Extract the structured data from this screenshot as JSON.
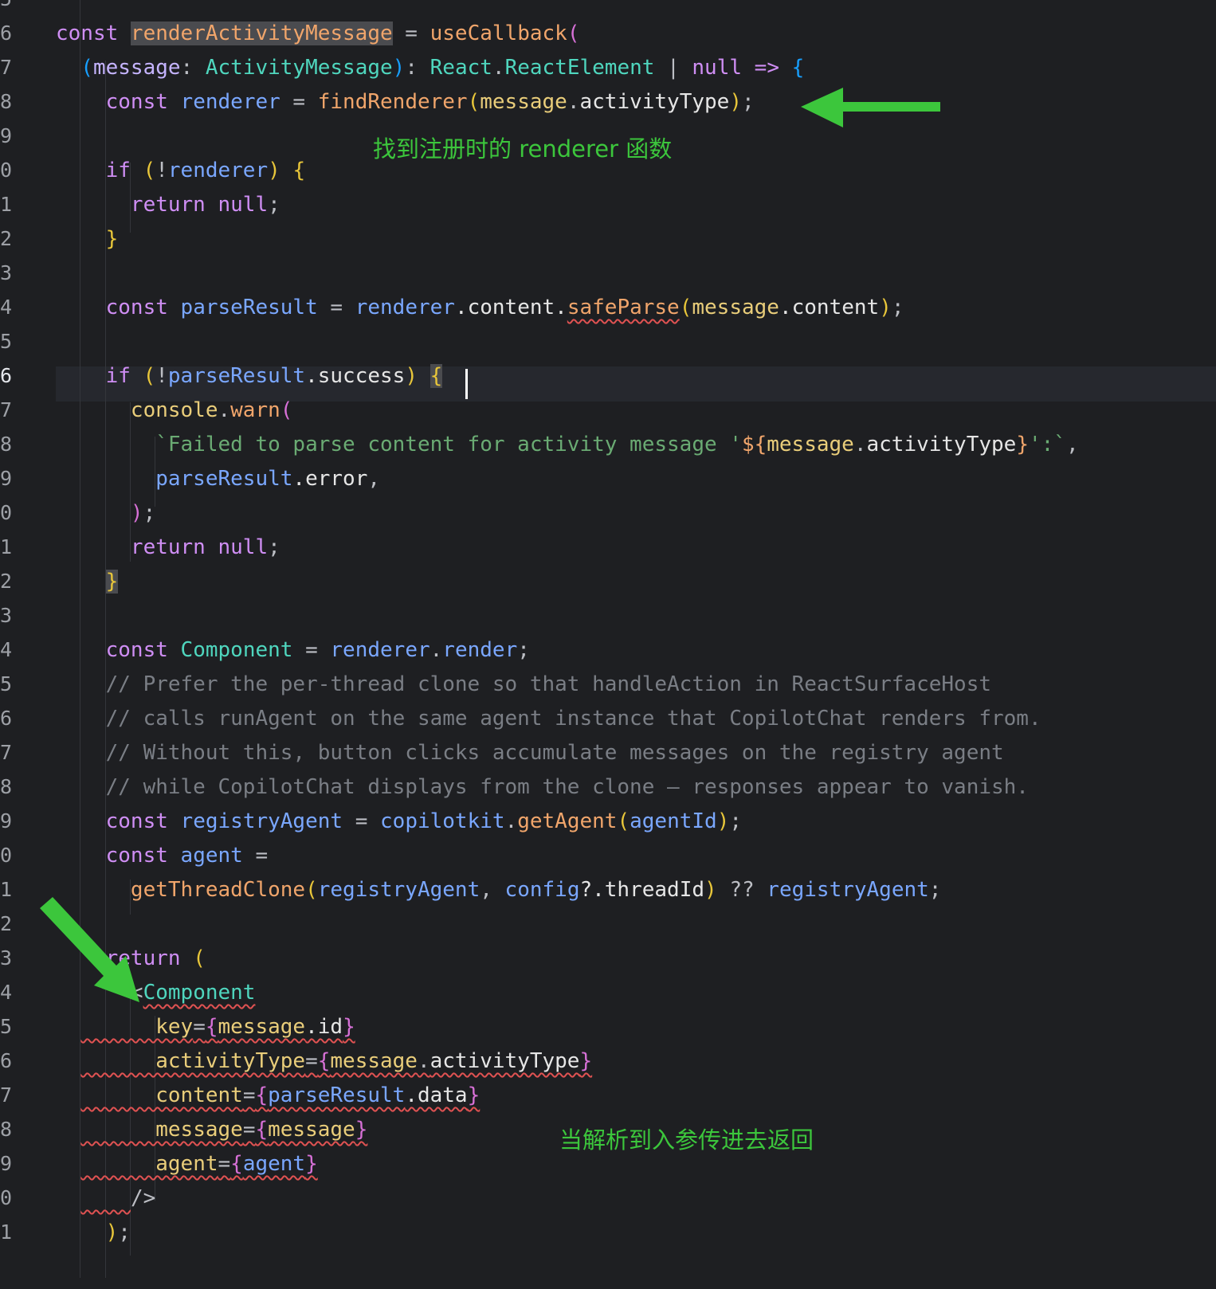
{
  "gutter": [
    "6",
    "7",
    "8",
    "9",
    "0",
    "1",
    "2",
    "3",
    "4",
    "5",
    "6",
    "7",
    "8",
    "9",
    "0",
    "1",
    "2",
    "3",
    "4",
    "5",
    "6",
    "7",
    "8",
    "9",
    "0",
    "1",
    "2",
    "3",
    "4",
    "5",
    "6",
    "7",
    "8",
    "9",
    "0",
    "1"
  ],
  "code": {
    "line01": [
      [
        "const ",
        "t-kw"
      ],
      [
        "renderActivityMessage",
        "t-fn t-hl"
      ],
      [
        " = ",
        "t-pl"
      ],
      [
        "useCallback",
        "t-fn"
      ],
      [
        "(",
        "t-b2"
      ]
    ],
    "line02": [
      [
        "  ",
        "t-pl"
      ],
      [
        "(",
        "t-b3"
      ],
      [
        "message",
        "t-par"
      ],
      [
        ": ",
        "t-pl"
      ],
      [
        "ActivityMessage",
        "t-typ"
      ],
      [
        ")",
        "t-b3"
      ],
      [
        ": ",
        "t-pl"
      ],
      [
        "React",
        "t-typ"
      ],
      [
        ".",
        "t-pl"
      ],
      [
        "ReactElement",
        "t-typ"
      ],
      [
        " | ",
        "t-pl"
      ],
      [
        "null",
        "t-kw"
      ],
      [
        " => ",
        "t-kw"
      ],
      [
        "{",
        "t-b3"
      ]
    ],
    "line03": [
      [
        "    const ",
        "t-kw"
      ],
      [
        "renderer",
        "t-var"
      ],
      [
        " = ",
        "t-pl"
      ],
      [
        "findRenderer",
        "t-fn"
      ],
      [
        "(",
        "t-b1"
      ],
      [
        "message",
        "t-attr"
      ],
      [
        ".",
        "t-pl"
      ],
      [
        "activityType",
        "t-prop"
      ],
      [
        ")",
        "t-b1"
      ],
      [
        ";",
        "t-pl"
      ]
    ],
    "line04": [],
    "line05": [
      [
        "    if ",
        "t-kw"
      ],
      [
        "(",
        "t-b1"
      ],
      [
        "!",
        "t-pl"
      ],
      [
        "renderer",
        "t-var"
      ],
      [
        ")",
        "t-b1"
      ],
      [
        " ",
        "t-pl"
      ],
      [
        "{",
        "t-b1"
      ]
    ],
    "line06": [
      [
        "      return ",
        "t-kw"
      ],
      [
        "null",
        "t-kw"
      ],
      [
        ";",
        "t-pl"
      ]
    ],
    "line07": [
      [
        "    ",
        "t-pl"
      ],
      [
        "}",
        "t-b1"
      ]
    ],
    "line08": [],
    "line09": [
      [
        "    const ",
        "t-kw"
      ],
      [
        "parseResult",
        "t-var"
      ],
      [
        " = ",
        "t-pl"
      ],
      [
        "renderer",
        "t-var"
      ],
      [
        ".content.",
        "t-prop"
      ],
      [
        "safeParse",
        "t-fn squig"
      ],
      [
        "(",
        "t-b1"
      ],
      [
        "message",
        "t-attr"
      ],
      [
        ".content",
        "t-prop"
      ],
      [
        ")",
        "t-b1"
      ],
      [
        ";",
        "t-pl"
      ]
    ],
    "line10": [],
    "line11": [
      [
        "    if ",
        "t-kw"
      ],
      [
        "(",
        "t-b1"
      ],
      [
        "!",
        "t-pl"
      ],
      [
        "parseResult",
        "t-var"
      ],
      [
        ".success",
        "t-prop"
      ],
      [
        ")",
        "t-b1"
      ],
      [
        " ",
        "t-pl"
      ],
      [
        "{",
        "t-b1 t-bm"
      ]
    ],
    "line12": [
      [
        "      console",
        "t-attr"
      ],
      [
        ".",
        "t-pl"
      ],
      [
        "warn",
        "t-fn"
      ],
      [
        "(",
        "t-b2"
      ]
    ],
    "line13": [
      [
        "        `Failed to parse content for activity message '",
        "t-str"
      ],
      [
        "${",
        "t-fn"
      ],
      [
        "message",
        "t-attr"
      ],
      [
        ".",
        "t-pl"
      ],
      [
        "activityType",
        "t-prop"
      ],
      [
        "}",
        "t-fn"
      ],
      [
        "':`",
        "t-str"
      ],
      [
        ",",
        "t-pl"
      ]
    ],
    "line14": [
      [
        "        parseResult",
        "t-var"
      ],
      [
        ".error",
        "t-prop"
      ],
      [
        ",",
        "t-pl"
      ]
    ],
    "line15": [
      [
        "      ",
        "t-pl"
      ],
      [
        ")",
        "t-b2"
      ],
      [
        ";",
        "t-pl"
      ]
    ],
    "line16": [
      [
        "      return ",
        "t-kw"
      ],
      [
        "null",
        "t-kw"
      ],
      [
        ";",
        "t-pl"
      ]
    ],
    "line17": [
      [
        "    ",
        "t-pl"
      ],
      [
        "}",
        "t-b1 t-bm"
      ]
    ],
    "line18": [],
    "line19": [
      [
        "    const ",
        "t-kw"
      ],
      [
        "Component",
        "t-typ"
      ],
      [
        " = ",
        "t-pl"
      ],
      [
        "renderer",
        "t-var"
      ],
      [
        ".",
        "t-pl"
      ],
      [
        "render",
        "t-var"
      ],
      [
        ";",
        "t-pl"
      ]
    ],
    "line20": [
      [
        "    // Prefer the per-thread clone so that handleAction in ReactSurfaceHost",
        "t-cmt"
      ]
    ],
    "line21": [
      [
        "    // calls runAgent on the same agent instance that CopilotChat renders from.",
        "t-cmt"
      ]
    ],
    "line22": [
      [
        "    // Without this, button clicks accumulate messages on the registry agent",
        "t-cmt"
      ]
    ],
    "line23": [
      [
        "    // while CopilotChat displays from the clone — responses appear to vanish.",
        "t-cmt"
      ]
    ],
    "line24": [
      [
        "    const ",
        "t-kw"
      ],
      [
        "registryAgent",
        "t-var"
      ],
      [
        " = ",
        "t-pl"
      ],
      [
        "copilotkit",
        "t-var"
      ],
      [
        ".",
        "t-pl"
      ],
      [
        "getAgent",
        "t-fn"
      ],
      [
        "(",
        "t-b1"
      ],
      [
        "agentId",
        "t-var"
      ],
      [
        ")",
        "t-b1"
      ],
      [
        ";",
        "t-pl"
      ]
    ],
    "line25": [
      [
        "    const ",
        "t-kw"
      ],
      [
        "agent",
        "t-var"
      ],
      [
        " =",
        "t-pl"
      ]
    ],
    "line26": [
      [
        "      getThreadClone",
        "t-fn"
      ],
      [
        "(",
        "t-b1"
      ],
      [
        "registryAgent",
        "t-var"
      ],
      [
        ", ",
        "t-pl"
      ],
      [
        "config",
        "t-var"
      ],
      [
        "?.threadId",
        "t-prop"
      ],
      [
        ")",
        "t-b1"
      ],
      [
        " ?? ",
        "t-pl"
      ],
      [
        "registryAgent",
        "t-var"
      ],
      [
        ";",
        "t-pl"
      ]
    ],
    "line27": [],
    "line28": [
      [
        "    return ",
        "t-kw"
      ],
      [
        "(",
        "t-b1"
      ]
    ],
    "line29": [
      [
        "      <",
        "t-pl"
      ],
      [
        "Component",
        "t-typ squig"
      ]
    ],
    "line30": [
      [
        "  ",
        "t-pl"
      ],
      [
        "      key",
        "t-attr squig"
      ],
      [
        "=",
        "t-pl squig"
      ],
      [
        "{",
        "t-b2 squig"
      ],
      [
        "message",
        "t-attr squig"
      ],
      [
        ".id",
        "t-prop squig"
      ],
      [
        "}",
        "t-b2 squig"
      ]
    ],
    "line31": [
      [
        "  ",
        "t-pl"
      ],
      [
        "      activityType",
        "t-attr squig"
      ],
      [
        "=",
        "t-pl squig"
      ],
      [
        "{",
        "t-b2 squig"
      ],
      [
        "message",
        "t-attr squig"
      ],
      [
        ".",
        "t-pl squig"
      ],
      [
        "activityType",
        "t-prop squig"
      ],
      [
        "}",
        "t-b2 squig"
      ]
    ],
    "line32": [
      [
        "  ",
        "t-pl"
      ],
      [
        "      content",
        "t-attr squig"
      ],
      [
        "=",
        "t-pl squig"
      ],
      [
        "{",
        "t-b2 squig"
      ],
      [
        "parseResult",
        "t-var squig"
      ],
      [
        ".data",
        "t-prop squig"
      ],
      [
        "}",
        "t-b2 squig"
      ]
    ],
    "line33": [
      [
        "  ",
        "t-pl"
      ],
      [
        "      message",
        "t-attr squig"
      ],
      [
        "=",
        "t-pl squig"
      ],
      [
        "{",
        "t-b2 squig"
      ],
      [
        "message",
        "t-attr squig"
      ],
      [
        "}",
        "t-b2 squig"
      ]
    ],
    "line34": [
      [
        "  ",
        "t-pl"
      ],
      [
        "      agent",
        "t-attr squig"
      ],
      [
        "=",
        "t-pl squig"
      ],
      [
        "{",
        "t-b2 squig"
      ],
      [
        "agent",
        "t-var squig"
      ],
      [
        "}",
        "t-b2 squig"
      ]
    ],
    "line35": [
      [
        "  ",
        "t-pl"
      ],
      [
        "    ",
        "t-pl squig"
      ],
      [
        "/>",
        "t-pl"
      ]
    ],
    "line36": [
      [
        "    ",
        "t-pl"
      ],
      [
        ")",
        "t-b1"
      ],
      [
        ";",
        "t-pl"
      ]
    ]
  },
  "annotations": {
    "find_renderer": "找到注册时的 renderer 函数",
    "return_component": "当解析到入参传进去返回"
  },
  "colors": {
    "background": "#1e1f22",
    "caret_line": "#26282e",
    "annotation_green": "#3cc63c",
    "error_squiggle": "#e05252"
  }
}
